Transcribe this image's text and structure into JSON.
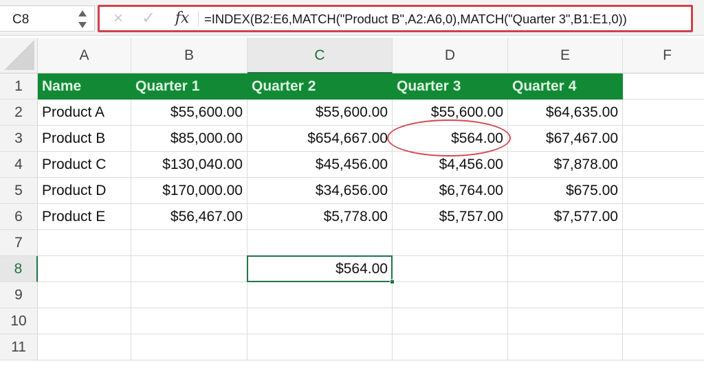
{
  "formula_bar": {
    "name_box": "C8",
    "cancel_icon": "×",
    "enter_icon": "✓",
    "fx_label": "fx",
    "formula": "=INDEX(B2:E6,MATCH(\"Product B\",A2:A6,0),MATCH(\"Quarter 3\",B1:E1,0))"
  },
  "sheet": {
    "active_cell": "C8",
    "active_column": "C",
    "active_row": "8",
    "columns": [
      "A",
      "B",
      "C",
      "D",
      "E",
      "F"
    ],
    "row_numbers": [
      "1",
      "2",
      "3",
      "4",
      "5",
      "6",
      "7",
      "8",
      "9",
      "10",
      "11"
    ],
    "header_fill": "#128a35",
    "header_row": [
      "Name",
      "Quarter 1",
      "Quarter 2",
      "Quarter 3",
      "Quarter 4"
    ],
    "rows": [
      [
        "Product A",
        "$55,600.00",
        "$55,600.00",
        "$55,600.00",
        "$64,635.00"
      ],
      [
        "Product B",
        "$85,000.00",
        "$654,667.00",
        "$564.00",
        "$67,467.00"
      ],
      [
        "Product C",
        "$130,040.00",
        "$45,456.00",
        "$4,456.00",
        "$7,878.00"
      ],
      [
        "Product D",
        "$170,000.00",
        "$34,656.00",
        "$6,764.00",
        "$675.00"
      ],
      [
        "Product E",
        "$56,467.00",
        "$5,778.00",
        "$5,757.00",
        "$7,577.00"
      ]
    ],
    "result_cell": {
      "ref": "C8",
      "value": "$564.00"
    },
    "highlighted_cell": {
      "ref": "D3",
      "annotation_color": "#d04a52"
    }
  }
}
